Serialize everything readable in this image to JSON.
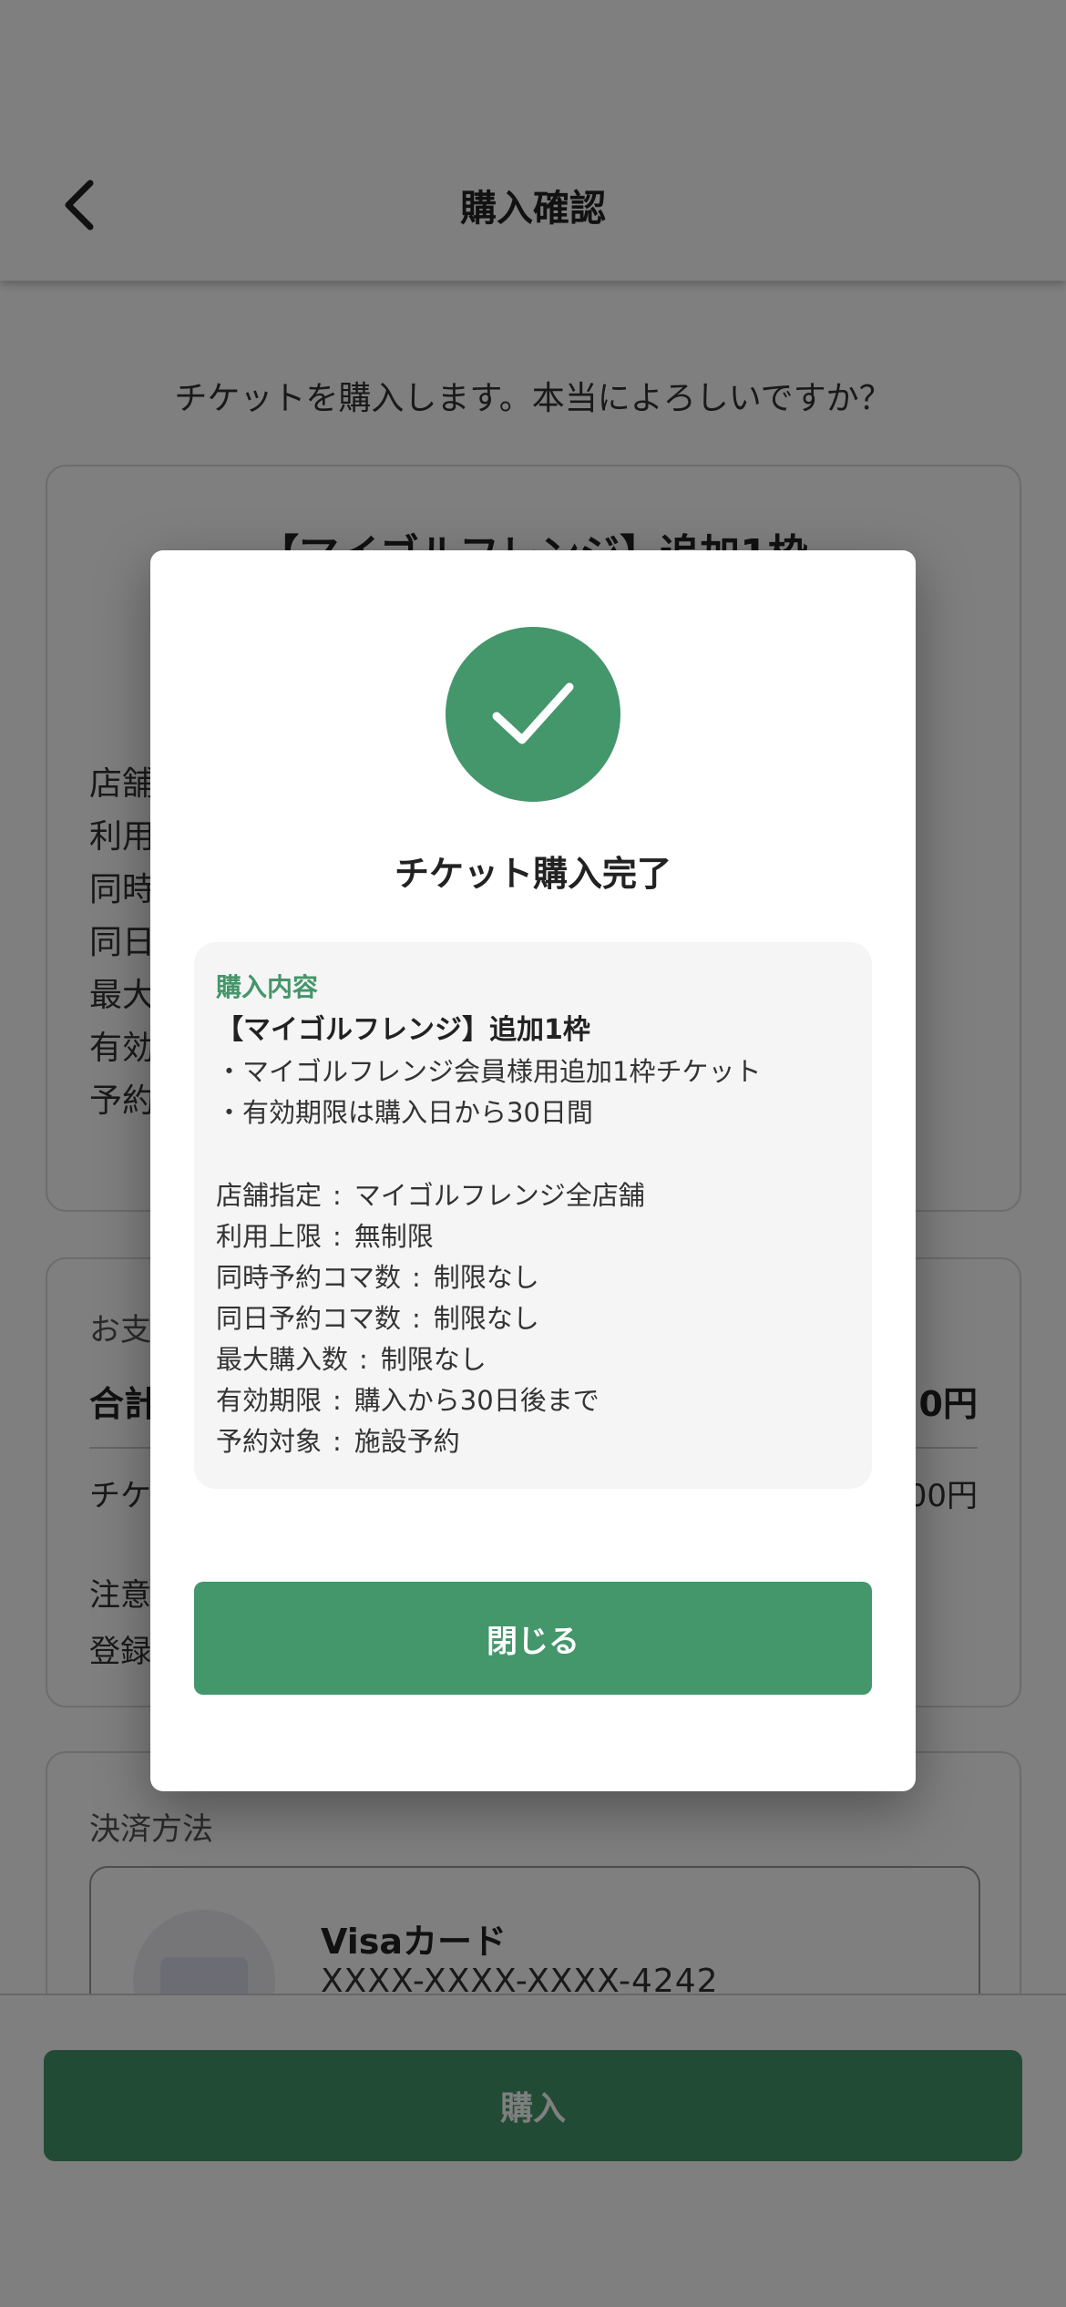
{
  "header": {
    "back_icon": "chevron-left-icon",
    "title": "購入確認"
  },
  "confirm_question": "チケットを購入します。本当によろしいですか？",
  "background_ticket": {
    "title": "【マイゴルフレンジ】追加1枠",
    "spec_labels_partial": [
      "店舗",
      "利用",
      "同時",
      "同日",
      "最大",
      "有効",
      "予約"
    ]
  },
  "background_payment": {
    "section_label_partial": "お支",
    "total_label_partial": "合計",
    "total_value_partial": "0円",
    "ticket_label_partial": "チケ",
    "ticket_value_partial": "00円",
    "notice_partial": [
      "注意",
      "登録"
    ]
  },
  "payment_method": {
    "label": "決済方法",
    "card_name": "Visaカード",
    "card_number": "XXXX-XXXX-XXXX-4242"
  },
  "purchase_button": "購入",
  "modal": {
    "icon": "check-icon",
    "title": "チケット購入完了",
    "details": {
      "heading": "購入内容",
      "product": "【マイゴルフレンジ】追加1枠",
      "lines": [
        "・マイゴルフレンジ会員様用追加1枠チケット",
        "・有効期限は購入日から30日間"
      ],
      "specs": [
        {
          "label": "店舗指定",
          "value": "マイゴルフレンジ全店舗"
        },
        {
          "label": "利用上限",
          "value": "無制限"
        },
        {
          "label": "同時予約コマ数",
          "value": "制限なし"
        },
        {
          "label": "同日予約コマ数",
          "value": "制限なし"
        },
        {
          "label": "最大購入数",
          "value": "制限なし"
        },
        {
          "label": "有効期限",
          "value": "購入から30日後まで"
        },
        {
          "label": "予約対象",
          "value": "施設予約"
        }
      ]
    },
    "close_button": "閉じる"
  },
  "colors": {
    "accent": "#44966b",
    "overlay": "rgba(0,0,0,0.5)"
  }
}
